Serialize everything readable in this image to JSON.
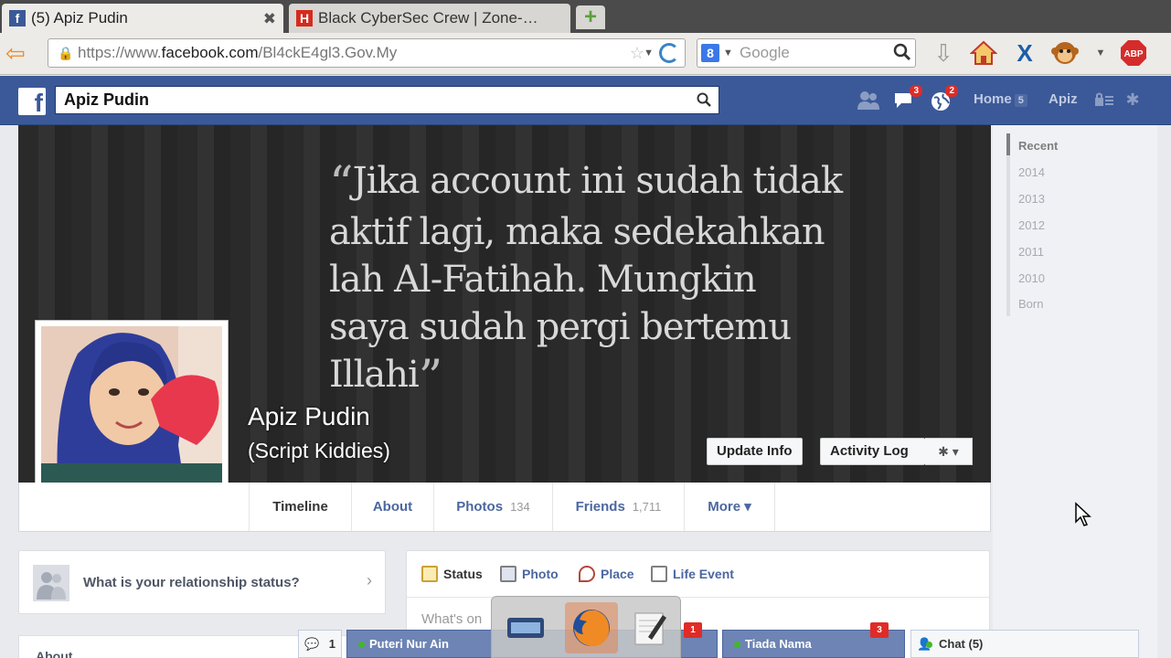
{
  "browser": {
    "tabs": [
      {
        "title": "(5) Apiz Pudin",
        "favicon": "facebook-icon",
        "active": true,
        "close": "✖"
      },
      {
        "title": "Black CyberSec Crew | Zone-…",
        "favicon": "h-icon",
        "active": false
      }
    ],
    "url_prefix": "https://www.",
    "url_domain": "facebook.com",
    "url_path": "/Bl4ckE4gl3.Gov.My",
    "search_placeholder": "Google",
    "search_engine_letter": "8",
    "toolbar_icons": [
      "download-icon",
      "home-icon",
      "x-icon",
      "monkey-icon",
      "adblock-icon"
    ],
    "abp_label": "ABP"
  },
  "facebook": {
    "logo": "f",
    "search_value": "Apiz Pudin",
    "friend_requests_icon": "friends-icon",
    "messages_badge": "3",
    "notifications_badge": "2",
    "home_label": "Home",
    "home_count": "5",
    "user_label": "Apiz",
    "accent": "#3b5998"
  },
  "cover": {
    "quote_lines": [
      "Jika account ini sudah tidak",
      "aktif lagi, maka sedekahkan",
      "lah Al-Fatihah. Mungkin",
      "saya sudah pergi bertemu",
      "Illahi"
    ],
    "quote_open": "“",
    "quote_close": "”"
  },
  "profile": {
    "name": "Apiz Pudin",
    "alternate_name": "(Script Kiddies)",
    "update_info": "Update Info",
    "activity_log": "Activity Log",
    "settings_glyph": "✱ ▾"
  },
  "profile_nav": [
    {
      "label": "Timeline",
      "count": ""
    },
    {
      "label": "About",
      "count": ""
    },
    {
      "label": "Photos",
      "count": "134"
    },
    {
      "label": "Friends",
      "count": "1,711"
    },
    {
      "label": "More ▾",
      "count": ""
    }
  ],
  "timeline_rail": [
    "Recent",
    "2014",
    "2013",
    "2012",
    "2011",
    "2010",
    "Born"
  ],
  "relationship_prompt": "What is your relationship status?",
  "about_heading": "About",
  "composer": {
    "tabs": [
      "Status",
      "Photo",
      "Place",
      "Life Event"
    ],
    "placeholder": "What's on"
  },
  "chat": {
    "count_label": "1",
    "tabs": [
      {
        "name": "Puteri Nur Ain",
        "badge": "1"
      },
      {
        "name": "Tiada Nama",
        "badge": "3"
      }
    ],
    "main_label": "Chat (5)"
  }
}
